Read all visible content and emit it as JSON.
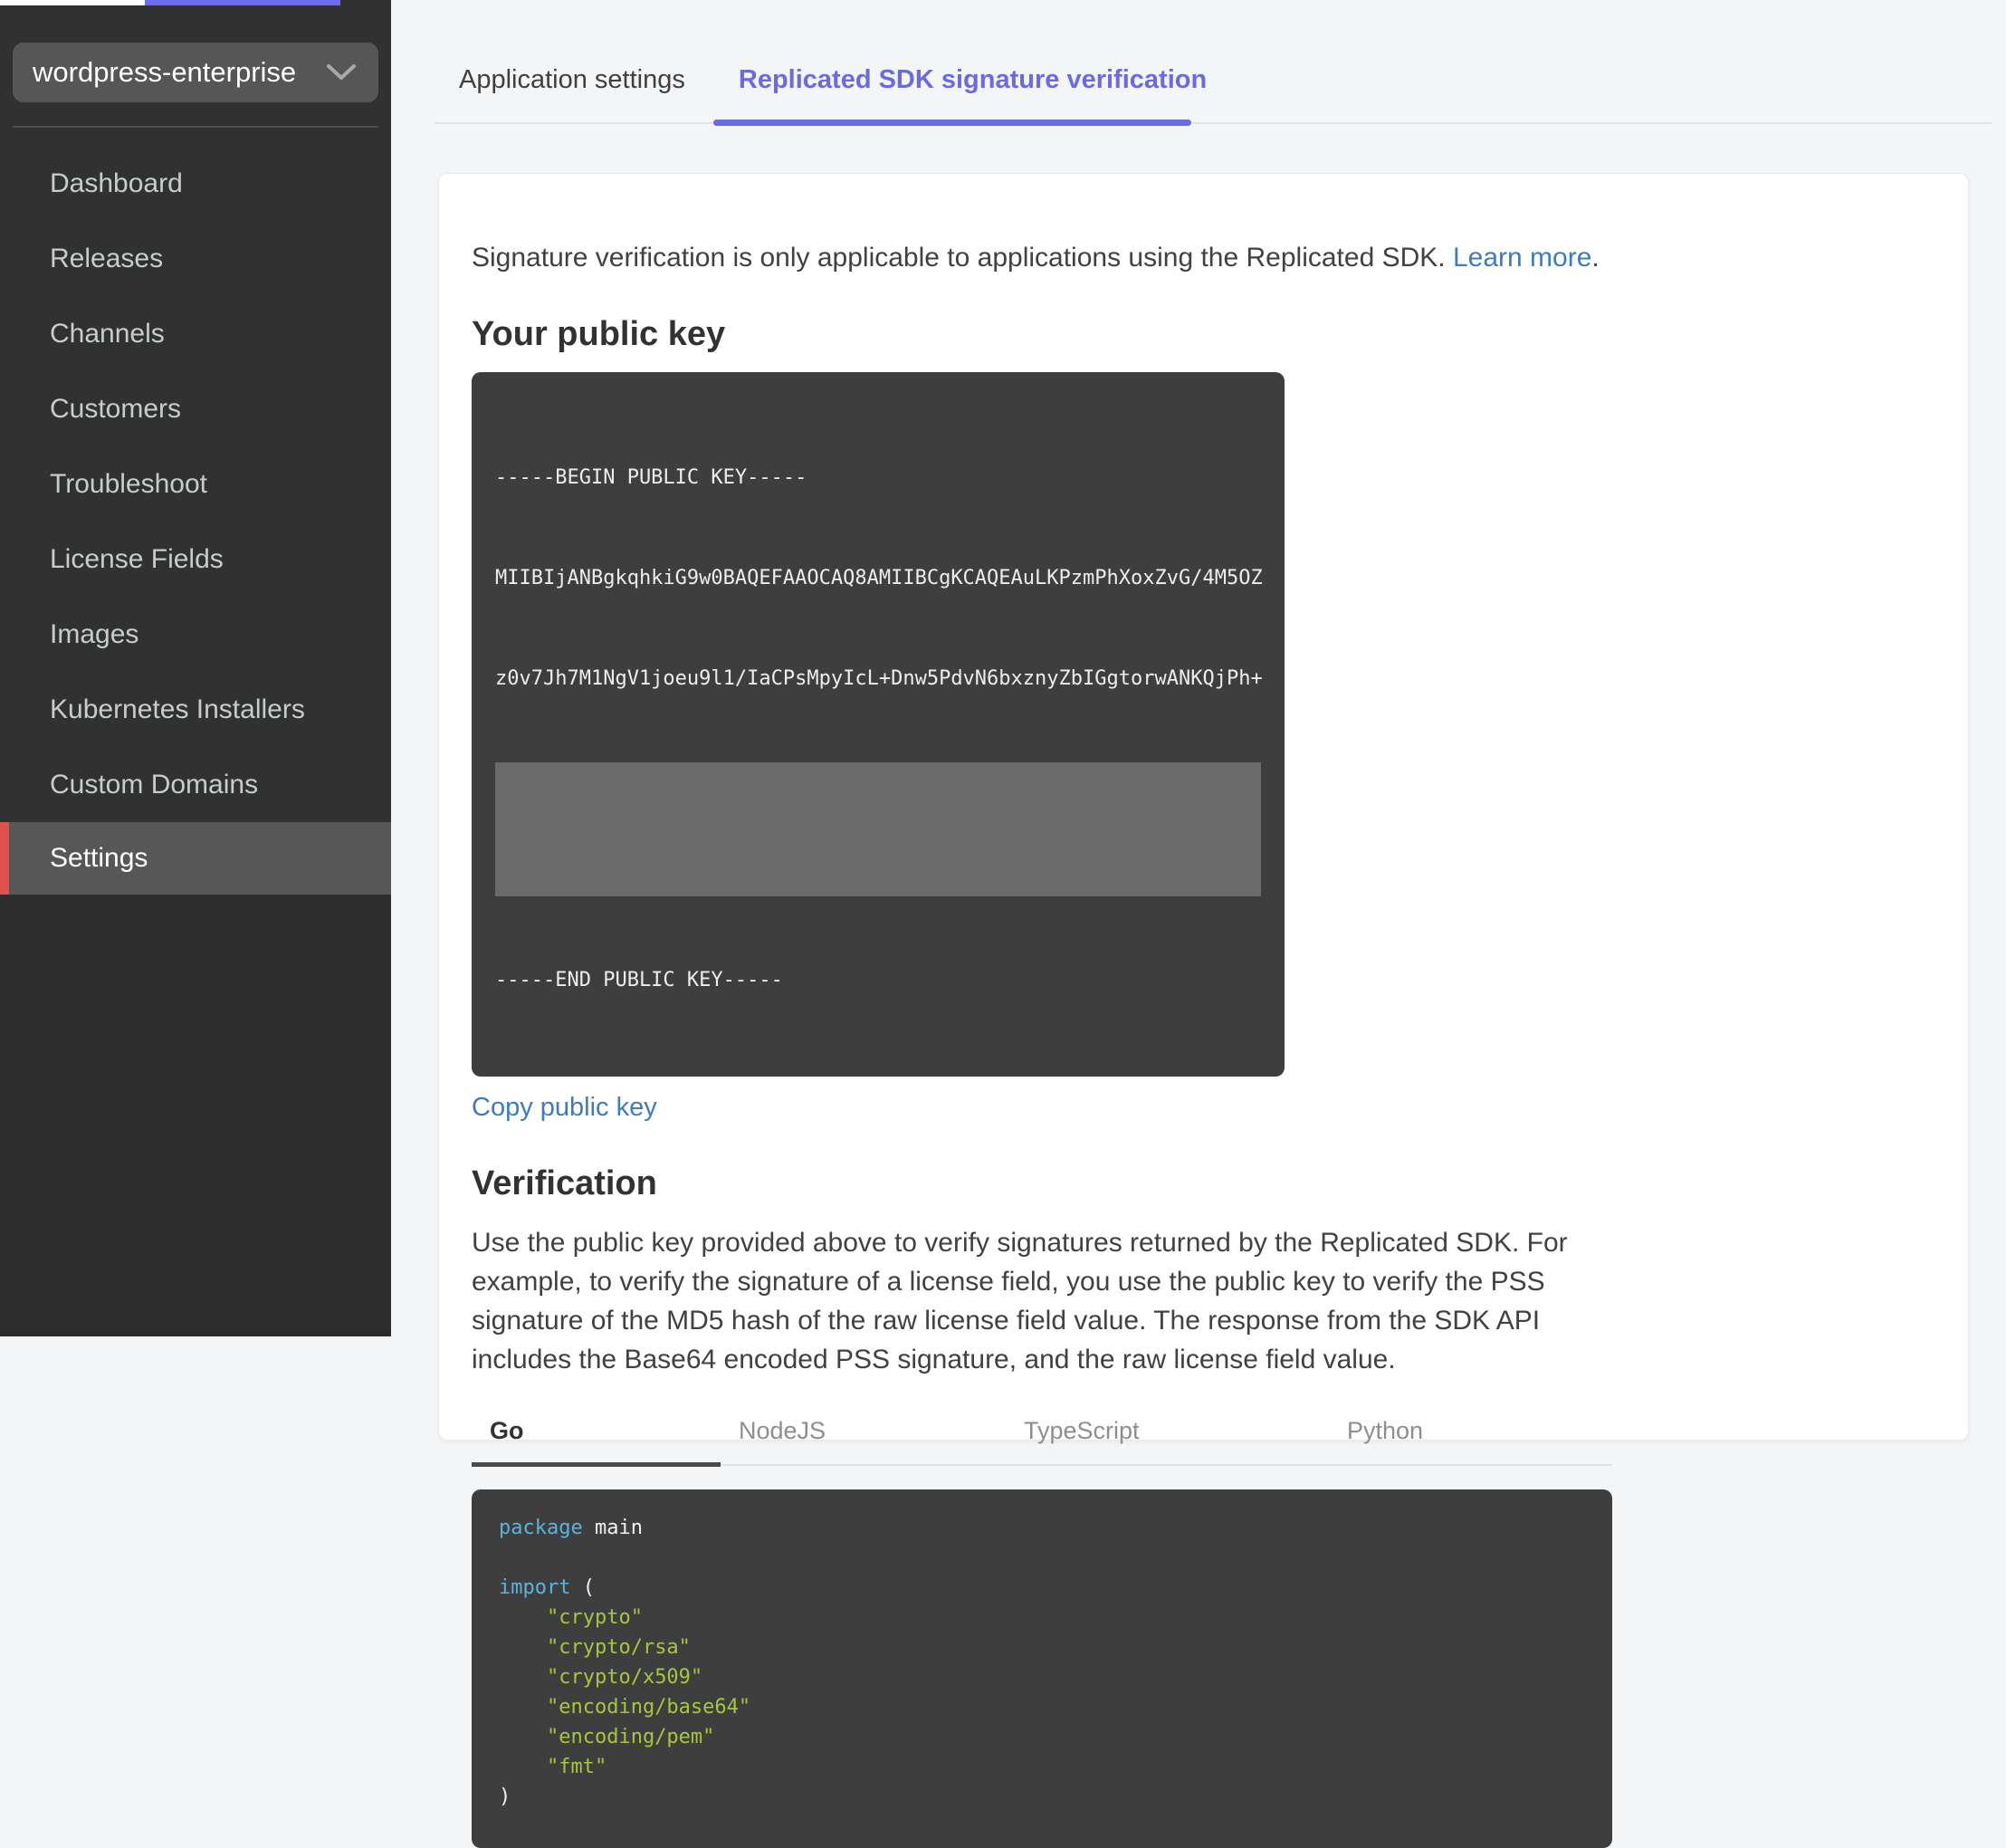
{
  "theme": {
    "topbar_purple": "#6c6cf0",
    "accent_purple": "#6b6be0",
    "active_item_red": "#e0514d",
    "link_blue": "#3d7cbe",
    "code_keyword_blue": "#5cb3dc",
    "code_string_green": "#a6c73c"
  },
  "sidebar": {
    "app_selector": {
      "value": "wordpress-enterprise",
      "icon": "chevron-down-icon"
    },
    "items": [
      {
        "label": "Dashboard"
      },
      {
        "label": "Releases"
      },
      {
        "label": "Channels"
      },
      {
        "label": "Customers"
      },
      {
        "label": "Troubleshoot"
      },
      {
        "label": "License Fields"
      },
      {
        "label": "Images"
      },
      {
        "label": "Kubernetes Installers"
      },
      {
        "label": "Custom Domains"
      },
      {
        "label": "Settings",
        "active": true
      }
    ]
  },
  "page_tabs": [
    {
      "label": "Application settings"
    },
    {
      "label": "Replicated SDK signature verification",
      "active": true
    }
  ],
  "content": {
    "intro": {
      "text": "Signature verification is only applicable to applications using the Replicated SDK.",
      "link_label": "Learn more",
      "after_link": "."
    },
    "public_key": {
      "heading": "Your public key",
      "begin_line": "-----BEGIN PUBLIC KEY-----",
      "visible_lines": [
        "MIIBIjANBgkqhkiG9w0BAQEFAAOCAQ8AMIIBCgKCAQEAuLKPzmPhXoxZvG/4M5OZ",
        "z0v7Jh7M1NgV1joeu9l1/IaCPsMpyIcL+Dnw5PdvN6bxznyZbIGgtorwANKQjPh+"
      ],
      "end_line": "-----END PUBLIC KEY-----",
      "copy_link_label": "Copy public key"
    },
    "verification": {
      "heading": "Verification",
      "description": "Use the public key provided above to verify signatures returned by the Replicated SDK. For example, to verify the signature of a license field, you use the public key to verify the PSS signature of the MD5 hash of the raw license field value. The response from the SDK API includes the Base64 encoded PSS signature, and the raw license field value.",
      "language_tabs": [
        {
          "label": "Go",
          "active": true
        },
        {
          "label": "NodeJS"
        },
        {
          "label": "TypeScript"
        },
        {
          "label": "Python"
        }
      ],
      "code_lines": [
        [
          {
            "t": "kw",
            "v": "package"
          },
          {
            "t": "plain",
            "v": " main"
          }
        ],
        [],
        [
          {
            "t": "kw",
            "v": "import"
          },
          {
            "t": "plain",
            "v": " ("
          }
        ],
        [
          {
            "t": "plain",
            "v": "    "
          },
          {
            "t": "str",
            "v": "\"crypto\""
          }
        ],
        [
          {
            "t": "plain",
            "v": "    "
          },
          {
            "t": "str",
            "v": "\"crypto/rsa\""
          }
        ],
        [
          {
            "t": "plain",
            "v": "    "
          },
          {
            "t": "str",
            "v": "\"crypto/x509\""
          }
        ],
        [
          {
            "t": "plain",
            "v": "    "
          },
          {
            "t": "str",
            "v": "\"encoding/base64\""
          }
        ],
        [
          {
            "t": "plain",
            "v": "    "
          },
          {
            "t": "str",
            "v": "\"encoding/pem\""
          }
        ],
        [
          {
            "t": "plain",
            "v": "    "
          },
          {
            "t": "str",
            "v": "\"fmt\""
          }
        ],
        [
          {
            "t": "plain",
            "v": ")"
          }
        ]
      ]
    }
  }
}
